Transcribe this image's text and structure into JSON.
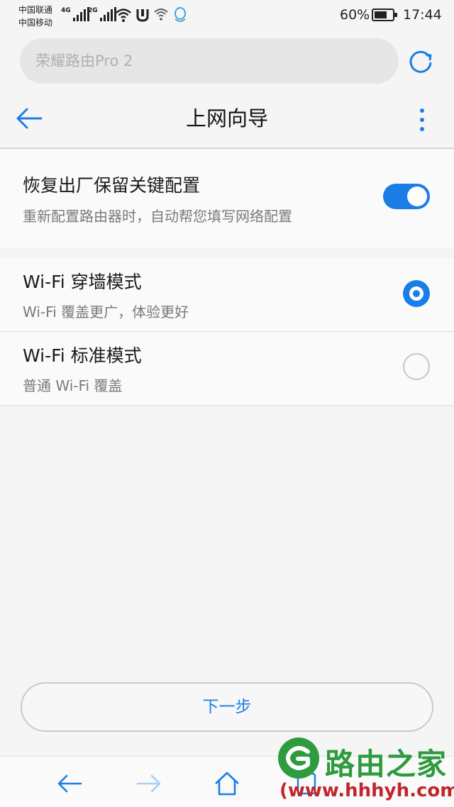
{
  "status_bar": {
    "carrier1": "中国联通",
    "carrier2": "中国移动",
    "signal1_tag": "4G",
    "signal2_tag": "2G",
    "battery": "60%",
    "time": "17:44"
  },
  "search": {
    "placeholder": "荣耀路由Pro 2"
  },
  "header": {
    "title": "上网向导"
  },
  "restore_setting": {
    "title": "恢复出厂保留关键配置",
    "subtitle": "重新配置路由器时，自动帮您填写网络配置",
    "enabled": true
  },
  "modes": [
    {
      "title": "Wi-Fi 穿墙模式",
      "subtitle": "Wi-Fi 覆盖更广，体验更好",
      "selected": true
    },
    {
      "title": "Wi-Fi 标准模式",
      "subtitle": "普通 Wi-Fi 覆盖",
      "selected": false
    }
  ],
  "next_button": "下一步",
  "colors": {
    "accent": "#1a7ee6",
    "watermark_green": "#2e9b3e",
    "watermark_red": "#c0262b"
  },
  "watermark": {
    "brand": "路由之家",
    "url": "(www.hhhyh.com)"
  }
}
